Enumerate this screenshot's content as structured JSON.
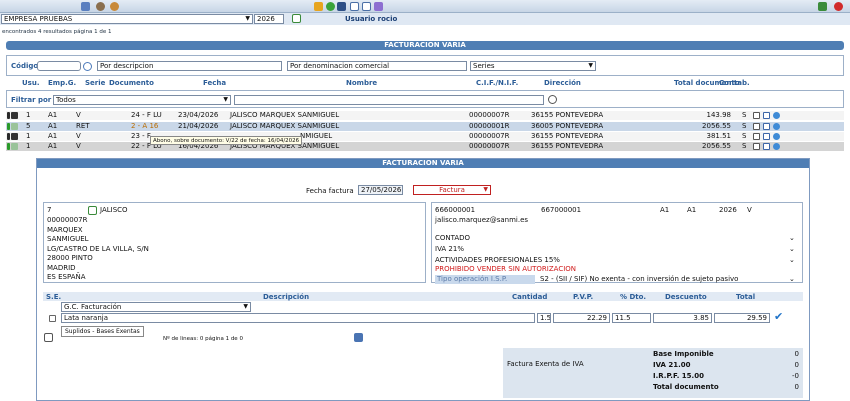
{
  "topbar": {
    "icons": [
      "calculator-icon",
      "users-icon",
      "person-icon",
      "key-icon",
      "refresh-icon",
      "calendar-icon",
      "mail-icon",
      "window-icon",
      "notes-icon",
      "home-icon",
      "power-icon"
    ]
  },
  "company": {
    "name": "EMPRESA PRUEBAS",
    "year": "2026",
    "user": "Usuario rocio"
  },
  "results": {
    "text": "encontrados 4 resultados  página 1 de 1"
  },
  "list": {
    "title": "FACTURACION VARIA",
    "codigo_label": "Código",
    "por_descripcion": "Por descripcion",
    "por_denominacion": "Por denominacion comercial",
    "series_value": "Series",
    "columns": {
      "usu": "Usu.",
      "emp": "Emp.G.",
      "serie": "Serie",
      "documento": "Documento",
      "fecha": "Fecha",
      "nombre": "Nombre",
      "cif": "C.I.F./N.I.F.",
      "direccion": "Dirección",
      "total": "Total documento",
      "contab": "Contab."
    },
    "filter_label": "Filtrar por",
    "filter_value": "Todos",
    "rows": [
      {
        "usu": "1",
        "emp": "A1",
        "serie": "V",
        "doc_num": "24 - F LU",
        "fecha": "23/04/2026",
        "nombre": "JALISCO MARQUEX SANMIGUEL",
        "cif": "00000007R",
        "direccion": "36155 PONTEVEDRA",
        "total": "143.98",
        "contab": "S"
      },
      {
        "usu": "5",
        "emp": "A1",
        "serie": "RET",
        "doc_num": "2 - A 16",
        "fecha": "21/04/2026",
        "nombre": "JALISCO MARQUEX SANMIGUEL",
        "cif": "00000001R",
        "direccion": "36005 PONTEVEDRA",
        "total": "2056.55",
        "contab": "S"
      },
      {
        "usu": "1",
        "emp": "A1",
        "serie": "V",
        "doc_num": "23 - F",
        "fecha": "",
        "nombre": "NMIGUEL",
        "cif": "00000007R",
        "direccion": "36155 PONTEVEDRA",
        "total": "381.51",
        "contab": "S"
      },
      {
        "usu": "1",
        "emp": "A1",
        "serie": "V",
        "doc_num": "22 - F LU",
        "fecha": "16/04/2026",
        "nombre": "JALISCO MARQUEX SANMIGUEL",
        "cif": "00000007R",
        "direccion": "36155 PONTEVEDRA",
        "total": "2056.55",
        "contab": "S"
      }
    ],
    "tooltip": "Abono, sobre documento: V/22 de fecha: 16/04/2026"
  },
  "modal": {
    "title": "FACTURACION VARIA",
    "fecha_label": "Fecha factura",
    "fecha_value": "27/05/2026",
    "tipo_value": "Factura",
    "client": {
      "code": "7",
      "name": "JALISCO",
      "lines": [
        "00000007R",
        "MARQUEX",
        "SANMIGUEL",
        "LG/CASTRO DE LA VILLA, S/N",
        "28000   PINTO",
        "MADRID",
        "ES  ESPAÑA"
      ]
    },
    "right": {
      "phone1": "666000001",
      "phone2": "667000001",
      "emp1": "A1",
      "emp2": "A1",
      "year": "2026",
      "serie": "V",
      "email": "jalisco.marquez@sanmi.es",
      "pago": "CONTADO",
      "iva": "IVA 21%",
      "actividad": "ACTIVIDADES PROFESIONALES 15%",
      "warning": "PROHIBIDO VENDER SIN AUTORIZACION",
      "tipo_label": "Tipo operación I.S.P.",
      "tipo_value": "S2 - (SII / SIF) No exenta - con inversión de sujeto pasivo"
    },
    "lines_header": {
      "se": "S.E.",
      "descripcion": "Descripción",
      "cantidad": "Cantidad",
      "pvp": "P.V.P.",
      "dto": "% Dto.",
      "descuento": "Descuento",
      "total": "Total"
    },
    "gc_value": "G.C. Facturación",
    "line": {
      "descripcion": "Lata naranja",
      "cantidad": "1.5",
      "pvp": "22.29",
      "dto": "11.5",
      "descuento": "3.85",
      "total": "29.59"
    },
    "suplidos_tooltip": "Suplidos - Bases Exentas",
    "footer_text": "Nº de lineas: 0   página 1 de 0",
    "exenta_label": "Factura Exenta de IVA",
    "totals": [
      {
        "label": "Base Imponible",
        "value": "0"
      },
      {
        "label": "IVA  21.00",
        "value": "0"
      },
      {
        "label": "I.R.P.F.  15.00",
        "value": "-0"
      },
      {
        "label": "Total documento",
        "value": "0"
      }
    ]
  },
  "colors": {
    "accent": "#4f7eb4",
    "header_text": "#2c5d97",
    "warning": "#d01818"
  }
}
